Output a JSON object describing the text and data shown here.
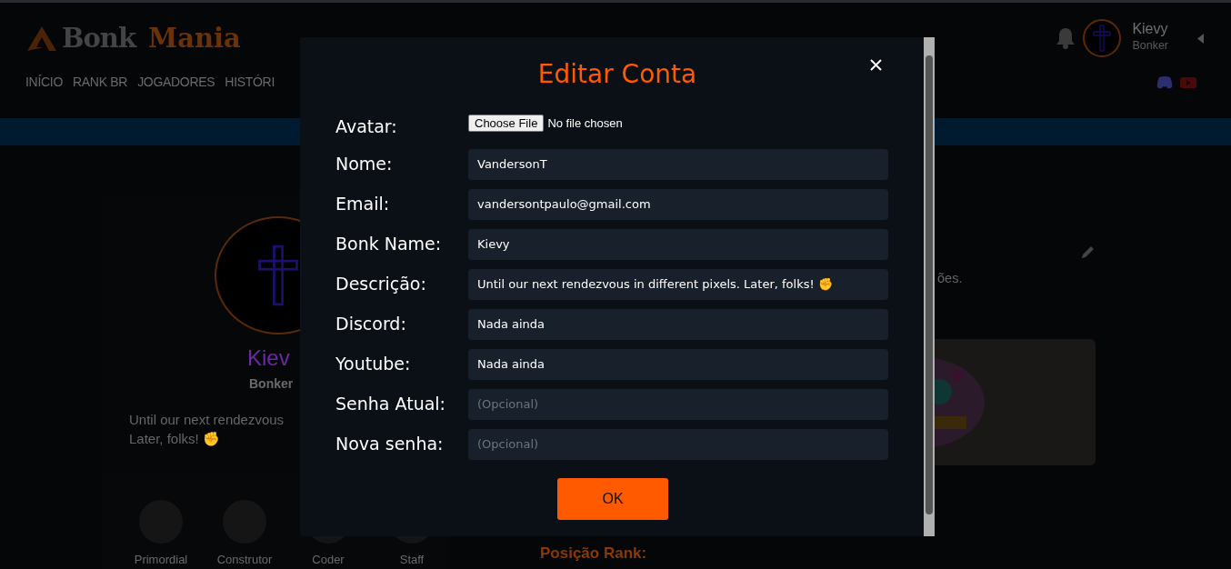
{
  "header": {
    "logo": {
      "part_1": "Bonk",
      "part_2": "Mania"
    },
    "nav": [
      {
        "label": "INÍCIO"
      },
      {
        "label": "RANK BR"
      },
      {
        "label": "JOGADORES"
      },
      {
        "label": "HISTÓRI"
      }
    ],
    "user": {
      "name": "Kievy",
      "role": "Bonker"
    }
  },
  "profile": {
    "name": "Kiev",
    "role": "Bonker",
    "description_lines": [
      "Until our next rendezvous",
      "Later, folks! ✊"
    ],
    "badges": [
      {
        "label": "Primordial"
      },
      {
        "label": "Construtor"
      },
      {
        "label": "Coder"
      },
      {
        "label": "Staff"
      }
    ]
  },
  "main": {
    "text_fragment": "ões.",
    "section_title": "Posição Rank:"
  },
  "modal": {
    "title": "Editar Conta",
    "avatar": {
      "label": "Avatar:",
      "button": "Choose File",
      "status": "No file chosen"
    },
    "fields": [
      {
        "label": "Nome:",
        "value": "VandersonT"
      },
      {
        "label": "Email:",
        "value": "vandersontpaulo@gmail.com"
      },
      {
        "label": "Bonk Name:",
        "value": "Kievy"
      },
      {
        "label": "Descrição:",
        "value": "Until our next rendezvous in different pixels. Later, folks! ✊"
      },
      {
        "label": "Discord:",
        "value": "Nada ainda"
      },
      {
        "label": "Youtube:",
        "value": "Nada ainda"
      },
      {
        "label": "Senha Atual:",
        "placeholder": "(Opcional)"
      },
      {
        "label": "Nova senha:",
        "placeholder": "(Opcional)"
      }
    ],
    "submit": "OK"
  }
}
